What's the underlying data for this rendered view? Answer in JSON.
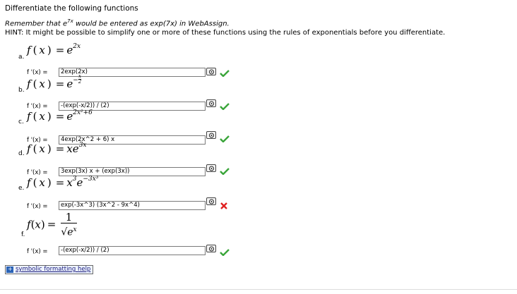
{
  "instructions": {
    "title": "Differentiate the following functions",
    "remember_prefix": "Remember that e",
    "remember_exp": "7x",
    "remember_suffix": " would be entered as exp(7x) in WebAssign.",
    "hint": "HINT: It might be possible to simplify one or more of these functions using the rules of exponentials before you differentiate."
  },
  "problems": [
    {
      "letter": "a.",
      "fx_exponent": "2x",
      "deriv_label": "f '(x) =",
      "answer": "2exp(2x)",
      "status": "correct"
    },
    {
      "letter": "b.",
      "fx_exponent_num": "x",
      "fx_exponent_den": "2",
      "deriv_label": "f '(x) =",
      "answer": "-(exp(-x/2)) / (2)",
      "status": "correct"
    },
    {
      "letter": "c.",
      "fx_exponent": "2x²+6",
      "deriv_label": "f '(x) =",
      "answer": "4exp(2x^2 + 6) x",
      "status": "correct"
    },
    {
      "letter": "d.",
      "fx_exponent": "3x",
      "deriv_label": "f '(x) =",
      "answer": "3exp(3x) x + (exp(3x))",
      "status": "correct"
    },
    {
      "letter": "e.",
      "fx_exp1": "3",
      "fx_exp2": "−3x³",
      "deriv_label": "f '(x) =",
      "answer": "exp(-3x^3) (3x^2 - 9x^4)",
      "status": "incorrect"
    },
    {
      "letter": "f.",
      "fx_num": "1",
      "fx_den_exp": "x",
      "deriv_label": "f '(x) =",
      "answer": "-(exp(-x/2)) / (2)",
      "status": "correct"
    }
  ],
  "help": {
    "label": "symbolic formatting help"
  },
  "icons": {
    "keyboard": "keyboard-icon",
    "correct": "checkmark-icon",
    "incorrect": "x-mark-icon"
  },
  "colors": {
    "correct": "#3aa53a",
    "incorrect": "#e02020"
  }
}
